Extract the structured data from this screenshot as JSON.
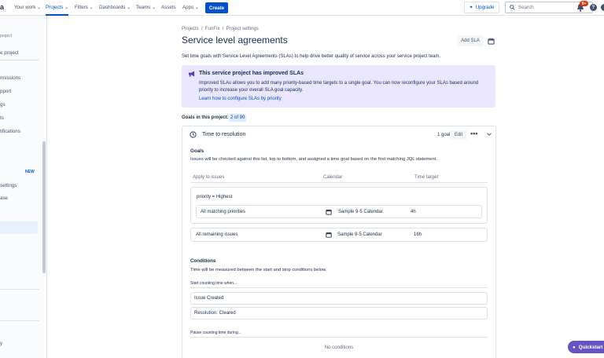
{
  "topnav": {
    "logo": "a",
    "items": [
      "Your work",
      "Projects",
      "Filters",
      "Dashboards",
      "Teams",
      "Assets",
      "Apps"
    ],
    "create_label": "Create",
    "upgrade_label": "Upgrade",
    "search_placeholder": "Search",
    "notifications_badge": "9+",
    "help_label": "?"
  },
  "sidebar": {
    "items": [
      "project",
      "e project",
      "rmissions",
      "pport",
      "gs",
      "ts",
      "tifications",
      "settings",
      "ase",
      "y"
    ],
    "new_badge": "NEW"
  },
  "breadcrumb": [
    "Projects",
    "FunFix",
    "Project settings"
  ],
  "page_title": "Service level agreements",
  "add_sla_label": "Add SLA",
  "intro_text": "Set time goals with Service Level Agreements (SLAs) to help drive better quality of service across your service project team.",
  "banner": {
    "title": "This service project has improved SLAs",
    "body": "Improved SLAs allows you to add many priority-based time targets to a single goal. You can now reconfigure your SLAs based around priority to increase your overall SLA goal capacity.",
    "link": "Learn how to configure SLAs by priority"
  },
  "goals_label": "Goals in this project:",
  "goals_count": "2 of 90",
  "card": {
    "title": "Time to resolution",
    "goal_count": "1 goal",
    "edit_label": "Edit",
    "more_label": "•••",
    "goals_heading": "Goals",
    "goals_desc": "Issues will be checked against this list, top to bottom, and assigned a time goal based on the first matching JQL statement.",
    "columns": [
      "Apply to issues",
      "Calendar",
      "Time target"
    ],
    "rule_jql": "priority = Highest",
    "rule_row": {
      "label": "All matching priorities",
      "calendar": "Sample 9-5 Calendar.",
      "target": "4h"
    },
    "remaining_row": {
      "label": "All remaining issues",
      "calendar": "Sample 9-5 Calendar",
      "target": "16h"
    },
    "conditions_heading": "Conditions",
    "conditions_desc": "Time will be measured between the start and stop conditions below.",
    "start_label": "Start counting time when...",
    "start_conditions": [
      "Issue Created",
      "Resolution: Cleared"
    ],
    "pause_label": "Pause counting time during...",
    "no_conditions": "No conditions"
  },
  "quickstart_label": "Quickstart",
  "colors": {
    "primary": "#0052cc",
    "banner_bg": "#eae6ff",
    "quickstart": "#6554c0",
    "badge": "#de350b"
  }
}
